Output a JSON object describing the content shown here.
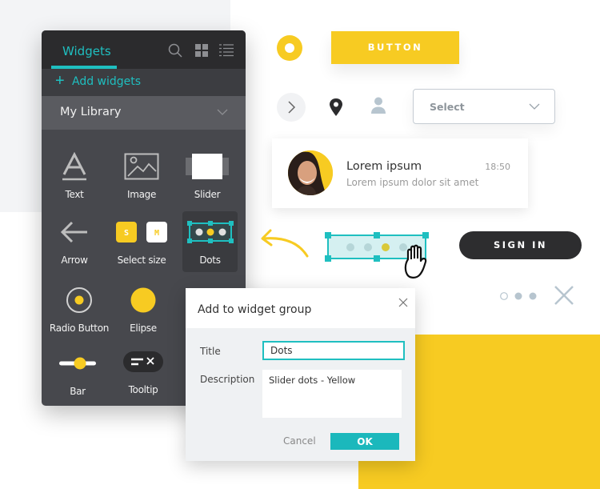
{
  "panel": {
    "tab_label": "Widgets",
    "header_icons": [
      "search-icon",
      "grid-view-icon",
      "list-view-icon"
    ],
    "add_label": "Add widgets",
    "library_label": "My Library",
    "items": [
      {
        "label": "Text",
        "icon": "text-icon"
      },
      {
        "label": "Image",
        "icon": "image-icon"
      },
      {
        "label": "Slider",
        "icon": "slider-icon"
      },
      {
        "label": "Arrow",
        "icon": "arrow-left-icon"
      },
      {
        "label": "Select size",
        "icon": "select-size-icon",
        "sizes": [
          "S",
          "M"
        ]
      },
      {
        "label": "Dots",
        "icon": "dots-icon",
        "selected": true
      },
      {
        "label": "Radio Button",
        "icon": "radio-button-icon"
      },
      {
        "label": "Elipse",
        "icon": "ellipse-icon"
      },
      {
        "label": "Bar",
        "icon": "bar-icon"
      },
      {
        "label": "Tooltip",
        "icon": "tooltip-icon"
      }
    ]
  },
  "showcase": {
    "button_label": "BUTTON",
    "select_placeholder": "Select",
    "card": {
      "name": "Lorem ipsum",
      "message": "Lorem ipsum dolor sit amet",
      "time": "18:50"
    },
    "signin_label": "SIGN IN",
    "pager": {
      "total": 3,
      "active": 1
    }
  },
  "dialog": {
    "title": "Add to widget group",
    "title_label": "Title",
    "title_value": "Dots",
    "description_label": "Description",
    "description_value": "Slider dots - Yellow",
    "cancel_label": "Cancel",
    "ok_label": "OK"
  },
  "colors": {
    "accent": "#1fbfc0",
    "yellow": "#f7cb22",
    "dark": "#2d2d2f",
    "panel": "#47484d"
  }
}
